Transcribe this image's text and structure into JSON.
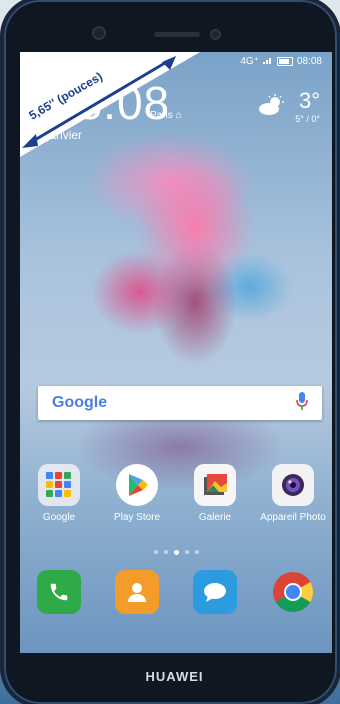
{
  "status_bar": {
    "network": "4G⁺",
    "time": "08:08"
  },
  "lock_widget": {
    "clock": "08:08",
    "city": "Paris",
    "date": "di 1 janvier"
  },
  "weather": {
    "temperature": "3°",
    "range": "5° / 0°",
    "icon": "partly-cloudy-icon"
  },
  "banner": {
    "text": "5,65'' (pouces)"
  },
  "search": {
    "logo": "Google",
    "icon": "microphone-icon"
  },
  "apps": [
    {
      "label": "Google",
      "icon": "google-folder-icon"
    },
    {
      "label": "Play Store",
      "icon": "play-store-icon"
    },
    {
      "label": "Galerie",
      "icon": "gallery-icon"
    },
    {
      "label": "Appareil Photo",
      "icon": "camera-icon"
    }
  ],
  "dock": [
    {
      "icon": "phone-icon"
    },
    {
      "icon": "contacts-icon"
    },
    {
      "icon": "messages-icon"
    },
    {
      "icon": "chrome-icon"
    }
  ],
  "brand": "HUAWEI",
  "colors": {
    "search_bg": "#ffffff",
    "phone": "#2eaa49",
    "contacts": "#f39c2a",
    "messages": "#2d9be0",
    "banner": "#1d3f8f"
  }
}
